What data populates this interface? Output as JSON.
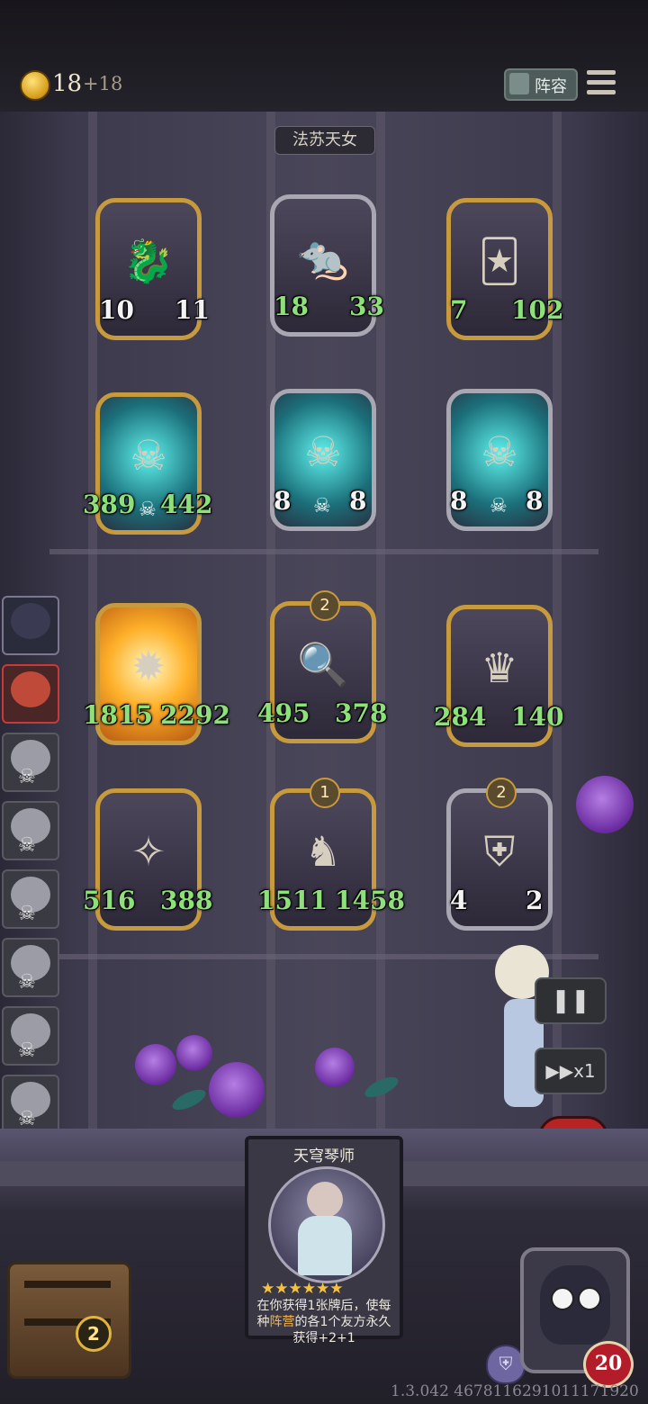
{
  "topbar": {
    "coins": "18",
    "coins_income": "+18",
    "lineup_label": "阵容"
  },
  "opponent": {
    "name": "法苏天女"
  },
  "enemy_board": [
    {
      "atk": "10",
      "hp": "11",
      "atk_buffed": false,
      "hp_buffed": false,
      "icon": "dragon-icon",
      "frame": "gold"
    },
    {
      "atk": "18",
      "hp": "33",
      "atk_buffed": true,
      "hp_buffed": true,
      "icon": "rat-icon",
      "frame": "silver"
    },
    {
      "atk": "7",
      "hp": "102",
      "atk_buffed": true,
      "hp_buffed": true,
      "icon": "jester-icon",
      "frame": "gold"
    },
    {
      "atk": "389",
      "hp": "442",
      "atk_buffed": true,
      "hp_buffed": true,
      "icon": "ghost-skull-icon",
      "frame": "gold"
    },
    {
      "atk": "8",
      "hp": "8",
      "atk_buffed": false,
      "hp_buffed": false,
      "icon": "ghost-skull-icon",
      "frame": "silver"
    },
    {
      "atk": "8",
      "hp": "8",
      "atk_buffed": false,
      "hp_buffed": false,
      "icon": "ghost-skull-icon",
      "frame": "silver"
    }
  ],
  "player_board": [
    {
      "atk": "1815",
      "hp": "2292",
      "tier": "",
      "icon": "flame-icon",
      "frame": "gold"
    },
    {
      "atk": "495",
      "hp": "378",
      "tier": "2",
      "icon": "detective-icon",
      "frame": "gold"
    },
    {
      "atk": "284",
      "hp": "140",
      "tier": "",
      "icon": "king-icon",
      "frame": "gold"
    },
    {
      "atk": "516",
      "hp": "388",
      "tier": "",
      "icon": "sorceress-icon",
      "frame": "gold"
    },
    {
      "atk": "1511",
      "hp": "1458",
      "tier": "1",
      "icon": "horse-icon",
      "frame": "gold"
    },
    {
      "atk": "4",
      "hp": "2",
      "tier": "2",
      "icon": "knight-icon",
      "frame": "silver"
    }
  ],
  "sidebar_players": [
    {
      "state": "me"
    },
    {
      "state": "active"
    },
    {
      "state": "dead"
    },
    {
      "state": "dead"
    },
    {
      "state": "dead"
    },
    {
      "state": "dead"
    },
    {
      "state": "dead"
    },
    {
      "state": "dead"
    }
  ],
  "controls": {
    "pause_glyph": "❚❚",
    "speed_label": "▶▶x1",
    "power_glyph": "⏻"
  },
  "chest": {
    "count": "2"
  },
  "pick_card": {
    "name": "天穹琴师",
    "stars": "★★★★★★",
    "text_pre": "在你获得1张牌后，使每种",
    "text_highlight": "阵营",
    "text_post": "的各1个友方永久获得+2+1"
  },
  "player": {
    "hp": "20"
  },
  "version": "1.3.042 4678116291011171920",
  "colors": {
    "buff_green": "#8ee07a",
    "gold_frame": "#c89a3e",
    "power_red": "#b82424"
  }
}
